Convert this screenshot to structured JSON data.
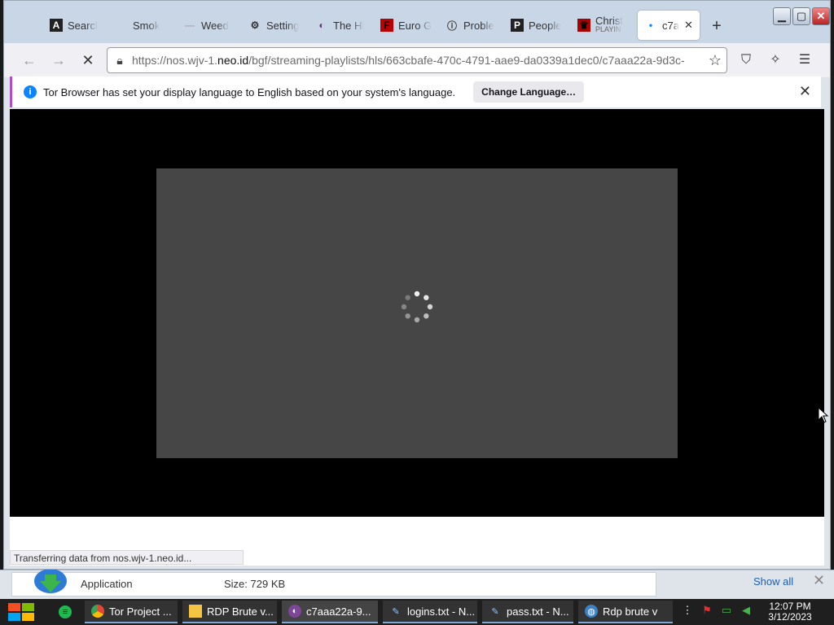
{
  "tabs": [
    {
      "label": "Searcl",
      "icon": "A"
    },
    {
      "label": "Smok",
      "icon": ""
    },
    {
      "label": "Weed",
      "icon": "—"
    },
    {
      "label": "Setting",
      "icon": "⚙"
    },
    {
      "label": "The Hi",
      "icon": "◐"
    },
    {
      "label": "Euro G",
      "icon": "F"
    },
    {
      "label": "Proble",
      "icon": "ⓘ"
    },
    {
      "label": "People",
      "icon": "P"
    },
    {
      "label": "Christ",
      "sublabel": "PLAYIN",
      "icon": "♛"
    },
    {
      "label": "c7a",
      "icon": "•",
      "active": true
    }
  ],
  "address": {
    "url_prefix": "https://nos.wjv-1.",
    "url_domain": "neo.id",
    "url_path": "/bgf/streaming-playlists/hls/663cbafe-470c-4791-aae9-da0339a1dec0/c7aaa22a-9d3c-"
  },
  "notification": {
    "message": "Tor Browser has set your display language to English based on your system's language.",
    "button": "Change Language…"
  },
  "status_text": "Transferring data from nos.wjv-1.neo.id...",
  "download": {
    "name": "Application",
    "size": "Size:  729 KB",
    "show_all": "Show all"
  },
  "taskbar": {
    "apps": [
      {
        "label": "Tor Project ...",
        "icon": "chrome-icon"
      },
      {
        "label": "RDP Brute v...",
        "icon": "folder-icon"
      },
      {
        "label": "c7aaa22a-9...",
        "icon": "tor-icon"
      },
      {
        "label": "logins.txt - N...",
        "icon": "notepad-icon"
      },
      {
        "label": "pass.txt - N...",
        "icon": "notepad-icon"
      },
      {
        "label": "Rdp brute v",
        "icon": "globe-icon"
      }
    ],
    "time": "12:07 PM",
    "date": "3/12/2023"
  },
  "colors": {
    "accent_purple": "#b14cd1",
    "info_blue": "#0a84ff",
    "link_blue": "#1a5fb4"
  }
}
